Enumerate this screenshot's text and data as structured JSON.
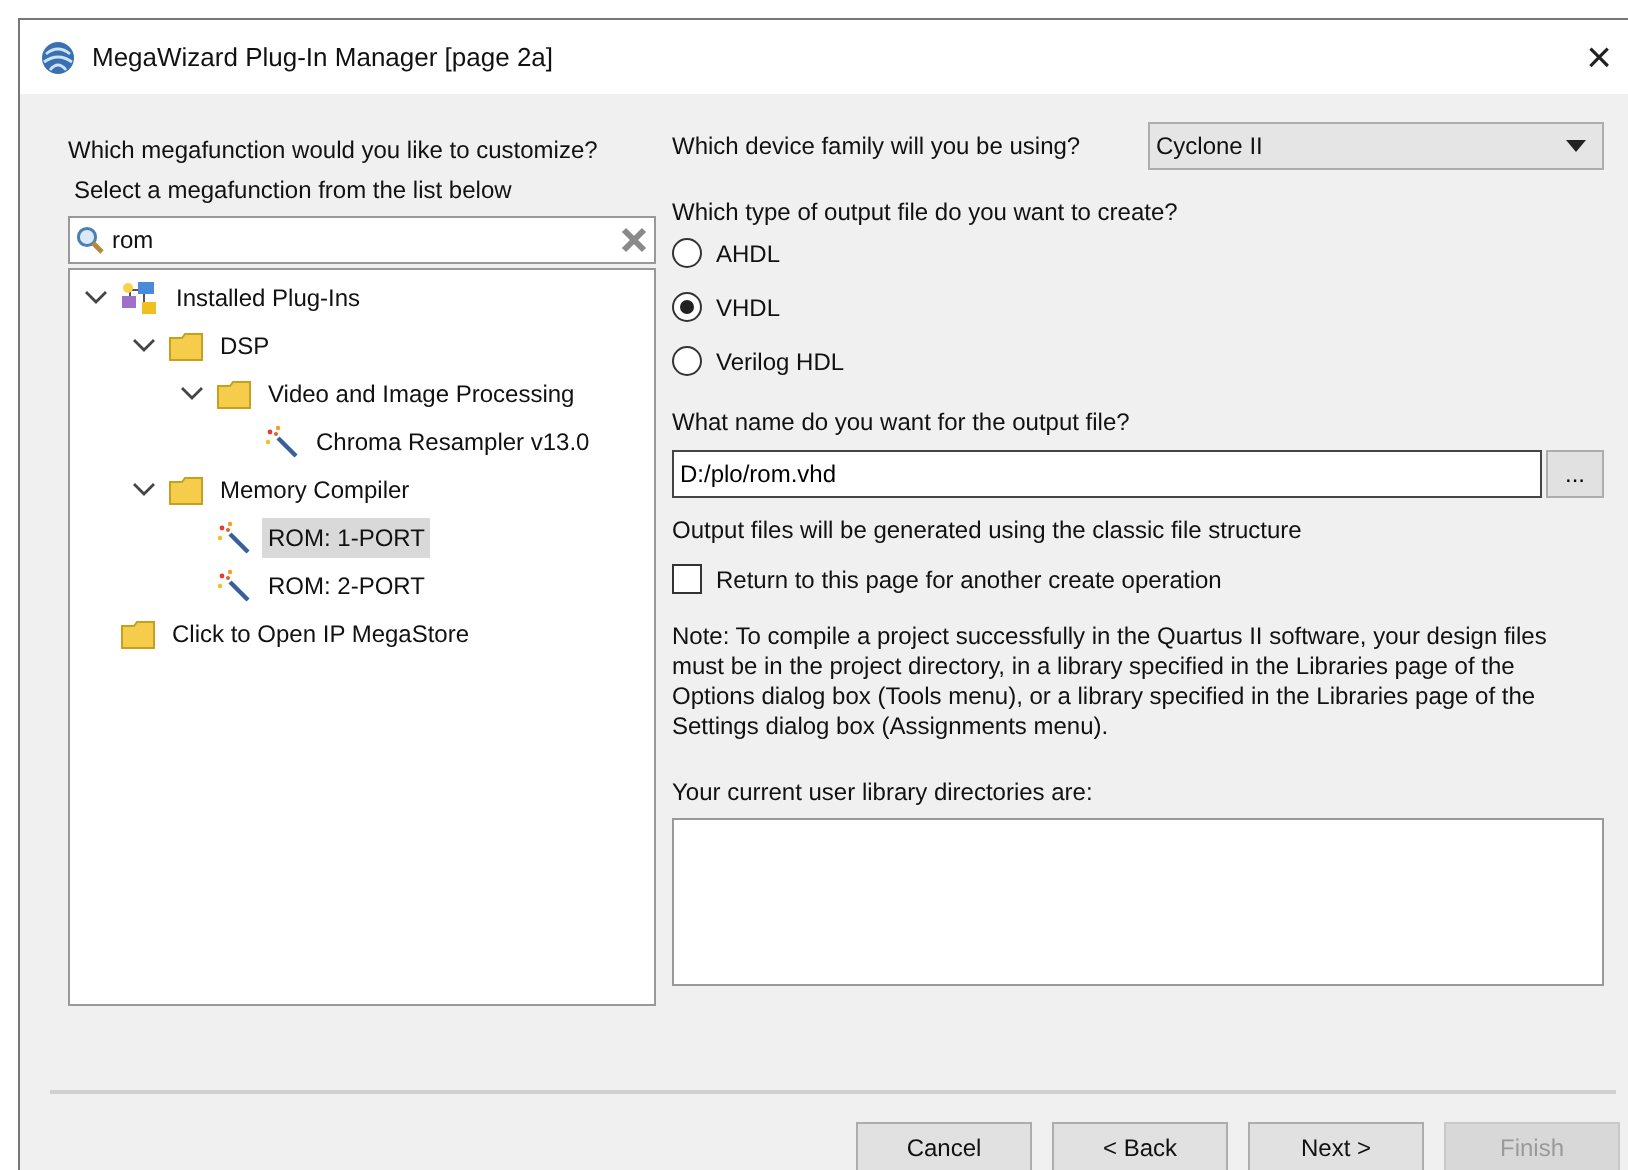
{
  "window": {
    "title": "MegaWizard Plug-In Manager [page 2a]",
    "close": "×"
  },
  "left": {
    "question": "Which megafunction would you like to customize?",
    "hint": "Select a megafunction from the list below",
    "search": {
      "value": "rom"
    },
    "tree": [
      {
        "label": "Installed Plug-Ins",
        "kind": "root",
        "expanded": true,
        "selected": false,
        "children": [
          {
            "label": "DSP",
            "kind": "folder",
            "expanded": true,
            "selected": false,
            "children": [
              {
                "label": "Video and Image Processing",
                "kind": "folder",
                "expanded": true,
                "selected": false,
                "children": [
                  {
                    "label": "Chroma Resampler v13.0",
                    "kind": "wizard",
                    "selected": false
                  }
                ]
              }
            ]
          },
          {
            "label": "Memory Compiler",
            "kind": "folder",
            "expanded": true,
            "selected": false,
            "children": [
              {
                "label": "ROM: 1-PORT",
                "kind": "wizard",
                "selected": true
              },
              {
                "label": "ROM: 2-PORT",
                "kind": "wizard",
                "selected": false
              }
            ]
          }
        ]
      },
      {
        "label": "Click to Open IP MegaStore",
        "kind": "folder",
        "selected": false
      }
    ]
  },
  "right": {
    "device_label": "Which device family will you be using?",
    "device": "Cyclone II",
    "type_label": "Which type of output file do you want to create?",
    "types": [
      {
        "label": "AHDL",
        "selected": false
      },
      {
        "label": "VHDL",
        "selected": true
      },
      {
        "label": "Verilog HDL",
        "selected": false
      }
    ],
    "name_label": "What name do you want for the output file?",
    "file_name": "D:/plo/rom.vhd",
    "browse": "...",
    "structure_note": "Output files will be generated using the classic file structure",
    "return_option": {
      "label": "Return to this page for another create operation",
      "checked": false
    },
    "note": "Note: To compile a project successfully in the Quartus II software, your design files must be in the project directory, in a library specified in the Libraries page of the Options dialog box (Tools menu), or a library specified in the Libraries page of the Settings dialog box (Assignments menu).",
    "library_label": "Your current user library directories are:"
  },
  "buttons": [
    {
      "label": "Cancel",
      "disabled": false
    },
    {
      "label": "< Back",
      "disabled": false
    },
    {
      "label": "Next >",
      "disabled": false
    },
    {
      "label": "Finish",
      "disabled": true
    }
  ]
}
